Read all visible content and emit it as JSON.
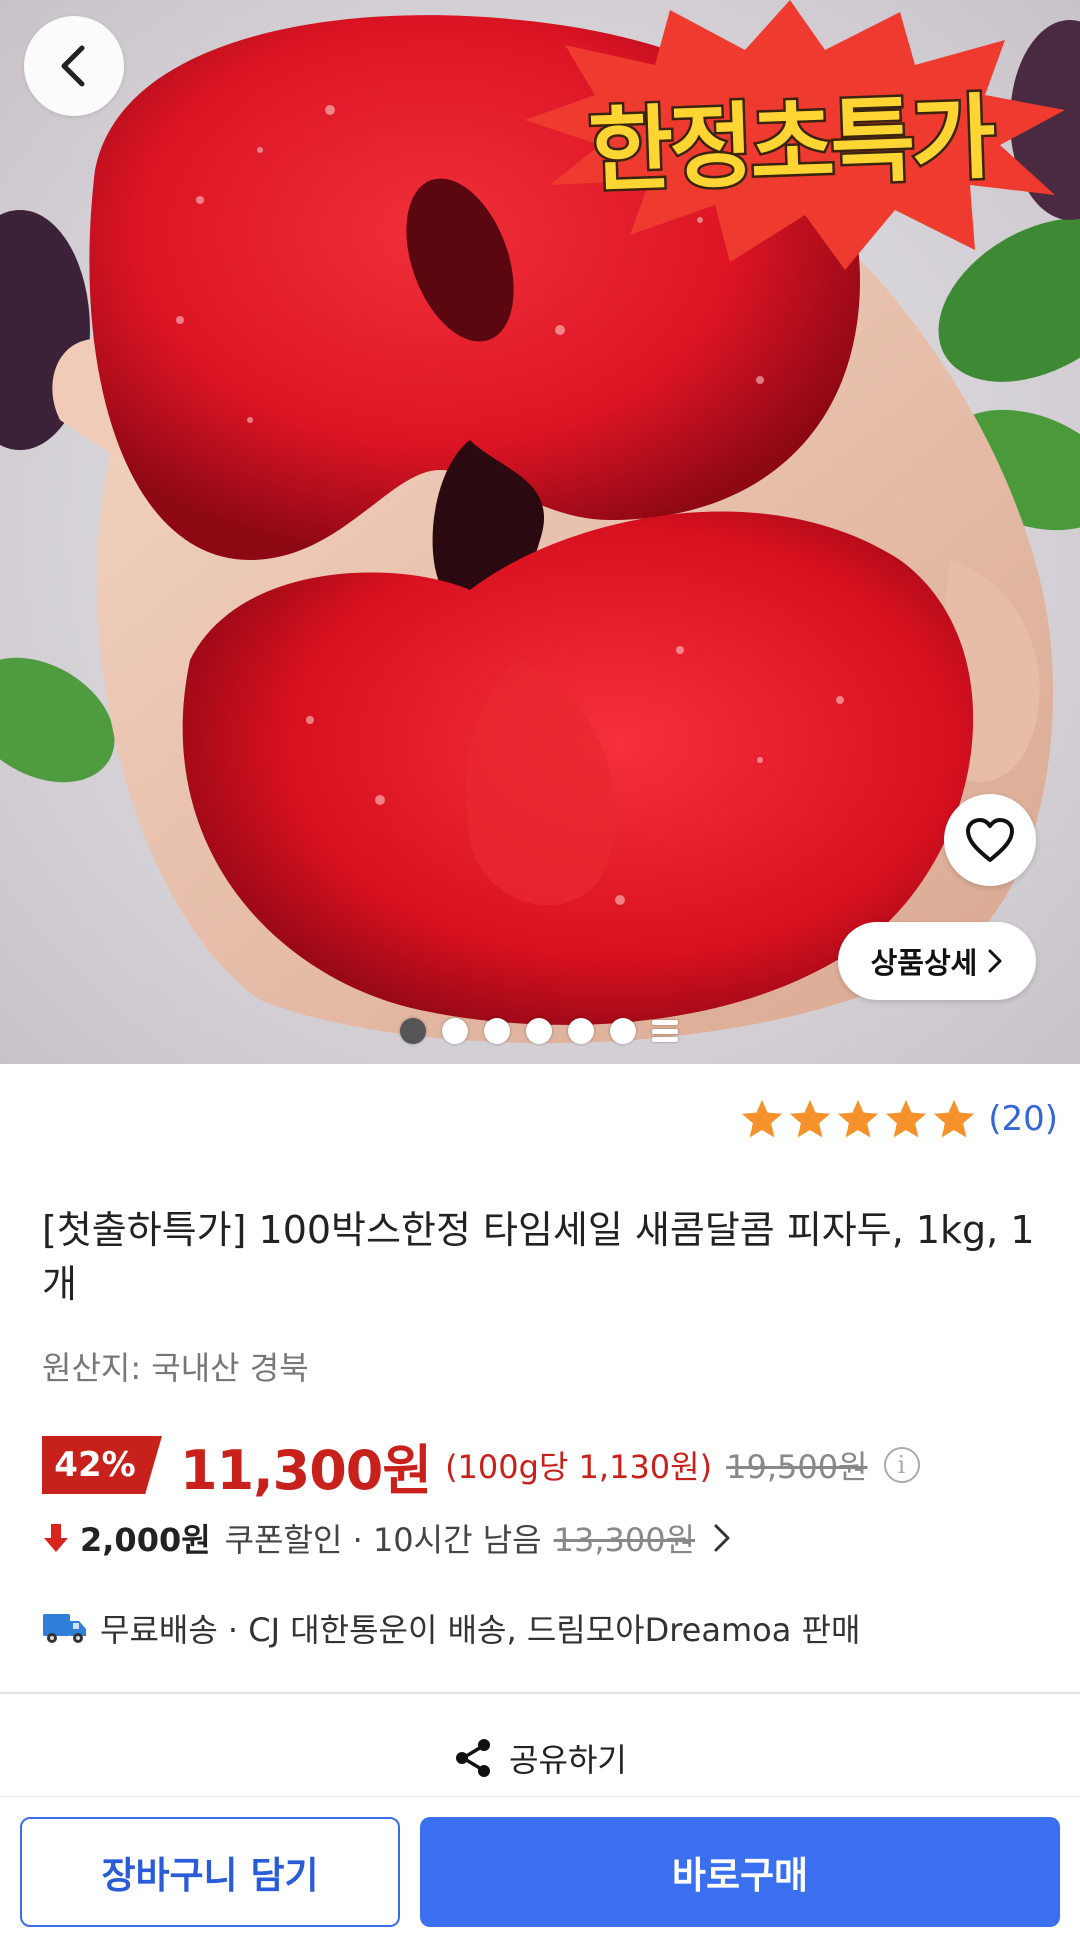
{
  "hero": {
    "banner_text": "한정초특가",
    "detail_button_label": "상품상세",
    "slide_count": 6,
    "active_slide": 0,
    "icons": {
      "back": "chevron-left-icon",
      "wishlist": "heart-outline-icon",
      "detail": "chevron-right-icon",
      "more_slides": "menu-lines-icon"
    }
  },
  "rating": {
    "stars": 5,
    "review_count": "(20)",
    "star_color": "#f6922b"
  },
  "product": {
    "title": "[첫출하특가] 100박스한정 타임세일 새콤달콤 피자두, 1kg, 1개",
    "origin": "원산지: 국내산 경북"
  },
  "price": {
    "discount": "42%",
    "sale_price": "11,300원",
    "unit_price": "(100g당 1,130원)",
    "original_price": "19,500원",
    "accent_color": "#c8201a"
  },
  "coupon": {
    "amount": "2,000원",
    "label": "쿠폰할인 · 10시간 남음",
    "before_coupon": "13,300원"
  },
  "shipping": {
    "text": "무료배송 · CJ 대한통운이 배송, 드림모아Dreamoa 판매"
  },
  "share": {
    "label": "공유하기"
  },
  "actions": {
    "cart_label": "장바구니 담기",
    "buy_label": "바로구매",
    "brand_color": "#3a70f0"
  }
}
